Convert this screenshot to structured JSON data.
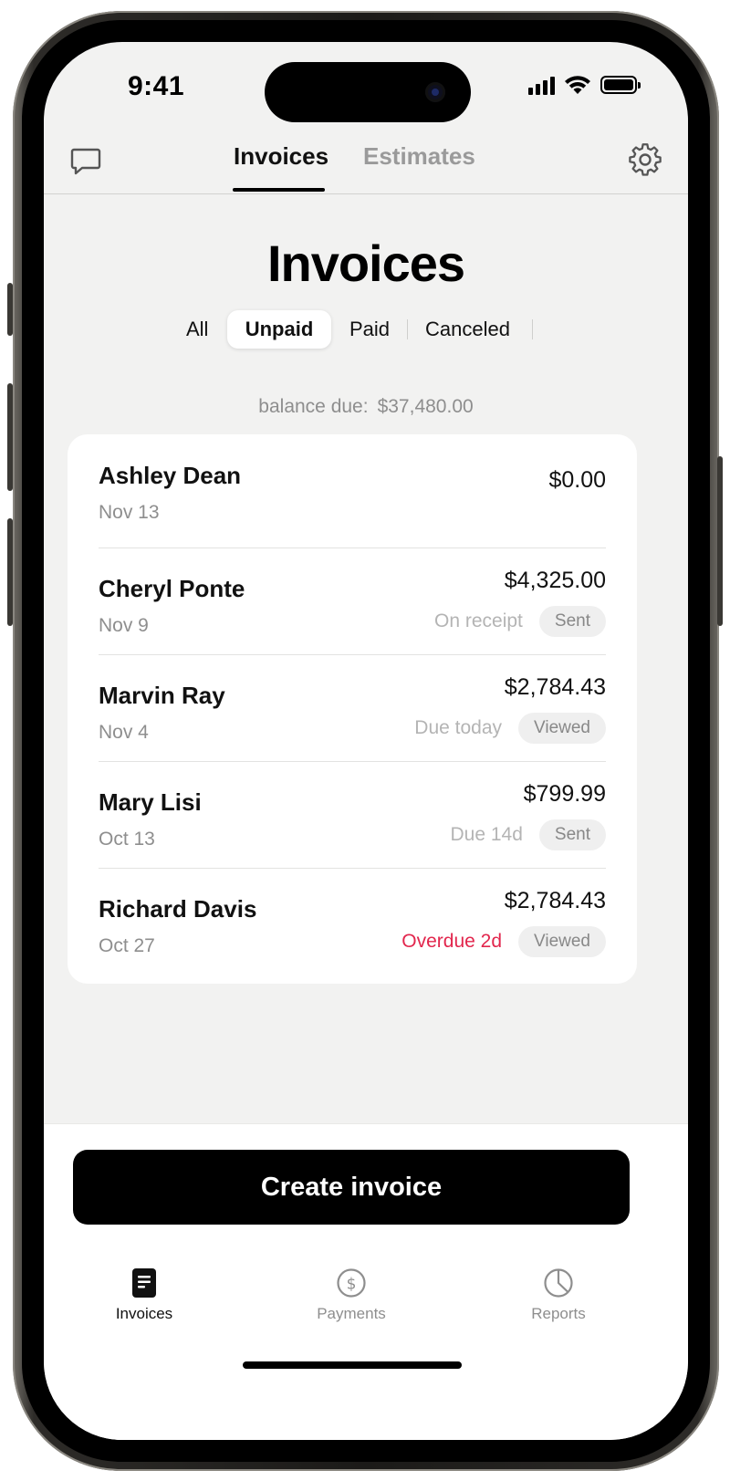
{
  "status_bar": {
    "time": "9:41"
  },
  "top_nav": {
    "tabs": [
      {
        "label": "Invoices",
        "active": true
      },
      {
        "label": "Estimates",
        "active": false
      }
    ]
  },
  "page": {
    "title": "Invoices"
  },
  "filters": {
    "items": [
      "All",
      "Unpaid",
      "Paid",
      "Canceled"
    ],
    "selected": "Unpaid"
  },
  "balance": {
    "label": "balance due:",
    "value": "$37,480.00"
  },
  "invoices": [
    {
      "name": "Ashley Dean",
      "date": "Nov 13",
      "amount": "$0.00",
      "due": "",
      "status": ""
    },
    {
      "name": "Cheryl Ponte",
      "date": "Nov 9",
      "amount": "$4,325.00",
      "due": "On receipt",
      "status": "Sent"
    },
    {
      "name": "Marvin Ray",
      "date": "Nov 4",
      "amount": "$2,784.43",
      "due": "Due today",
      "status": "Viewed"
    },
    {
      "name": "Mary Lisi",
      "date": "Oct 13",
      "amount": "$799.99",
      "due": "Due 14d",
      "status": "Sent"
    },
    {
      "name": "Richard Davis",
      "date": "Oct 27",
      "amount": "$2,784.43",
      "due": "Overdue 2d",
      "status": "Viewed"
    }
  ],
  "create_button": {
    "label": "Create invoice"
  },
  "tab_bar": {
    "items": [
      {
        "label": "Invoices",
        "icon": "document-icon",
        "active": true
      },
      {
        "label": "Payments",
        "icon": "dollar-circle-icon",
        "active": false
      },
      {
        "label": "Reports",
        "icon": "pie-chart-icon",
        "active": false
      }
    ]
  },
  "colors": {
    "accent": "#000000",
    "overdue": "#e2264d",
    "muted": "#8e8e8e",
    "background": "#f2f2f1"
  }
}
